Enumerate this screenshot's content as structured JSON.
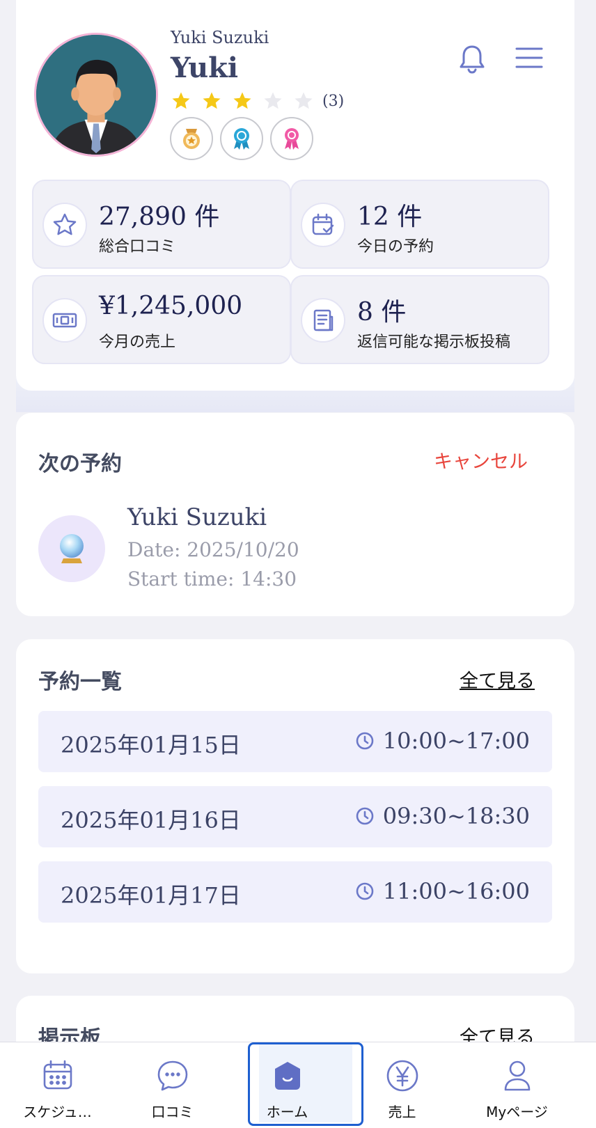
{
  "profile": {
    "sub_name": "Yuki Suzuki",
    "display_name": "Yuki",
    "rating": 3,
    "rating_max": 5,
    "rating_count": "(3)",
    "badges": [
      "gold-medal-badge",
      "blue-ribbon-badge",
      "pink-ribbon-badge"
    ]
  },
  "header": {
    "bell_icon": "bell-icon",
    "menu_icon": "hamburger-menu-icon"
  },
  "stats": [
    {
      "value": "27,890 件",
      "label": "総合口コミ",
      "icon": "star-icon"
    },
    {
      "value": "12 件",
      "label": "今日の予約",
      "icon": "calendar-check-icon"
    },
    {
      "value": "¥1,245,000",
      "label": "今月の売上",
      "icon": "banknote-icon"
    },
    {
      "value": "8 件",
      "label": "返信可能な掲示板投稿",
      "icon": "document-icon"
    }
  ],
  "next_reservation": {
    "title": "次の予約",
    "cancel_label": "キャンセル",
    "client_name": "Yuki Suzuki",
    "date": "Date: 2025/10/20",
    "start_time": "Start time: 14:30",
    "icon": "crystal-ball-icon"
  },
  "reservation_list": {
    "title": "予約一覧",
    "view_all": "全て見る",
    "rows": [
      {
        "date": "2025年01月15日",
        "time": "10:00~17:00"
      },
      {
        "date": "2025年01月16日",
        "time": "09:30~18:30"
      },
      {
        "date": "2025年01月17日",
        "time": "11:00~16:00"
      }
    ]
  },
  "board": {
    "title": "掲示板",
    "view_all": "全て見る"
  },
  "colors": {
    "accent": "#6b78c8",
    "active_border": "#1e5fd0",
    "cancel_red": "#e8453c",
    "star_gold": "#f5c817"
  },
  "bottom_nav": {
    "active": "ホーム",
    "items": [
      {
        "label": "スケジュ…",
        "icon": "calendar-icon"
      },
      {
        "label": "口コミ",
        "icon": "chat-bubble-icon"
      },
      {
        "label": "ホーム",
        "icon": "home-icon"
      },
      {
        "label": "売上",
        "icon": "yen-icon"
      },
      {
        "label": "Myページ",
        "icon": "user-icon"
      }
    ]
  }
}
